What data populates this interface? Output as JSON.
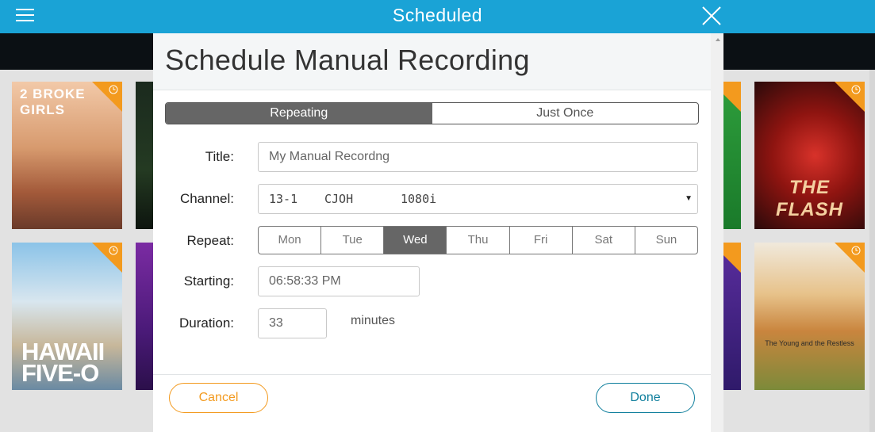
{
  "topbar": {
    "title": "Scheduled",
    "menu_icon": "hamburger-menu-icon",
    "close_icon": "close-icon",
    "color": "#1aa3d6"
  },
  "posters": {
    "broke_girls": {
      "caption": "2 BROKE GIRLS"
    },
    "hawaii_five_o": {
      "caption": "HAWAII FIVE-O"
    },
    "the_flash": {
      "caption": "THE FLASH"
    },
    "young_restless": {
      "caption": "The Young and the Restless"
    },
    "badge_icon": "clock-icon",
    "badge_color": "#f39a1e"
  },
  "modal": {
    "title": "Schedule Manual Recording",
    "mode": {
      "options": [
        "Repeating",
        "Just Once"
      ],
      "selected": "Repeating"
    },
    "title_label": "Title:",
    "title_value": "My Manual Recordng",
    "channel_label": "Channel:",
    "channel": {
      "number": "13-1",
      "name": "CJOH",
      "resolution": "1080i"
    },
    "repeat_label": "Repeat:",
    "days": [
      "Mon",
      "Tue",
      "Wed",
      "Thu",
      "Fri",
      "Sat",
      "Sun"
    ],
    "selected_day": "Wed",
    "starting_label": "Starting:",
    "starting_value": "06:58:33 PM",
    "duration_label": "Duration:",
    "duration_value": "33",
    "duration_unit": "minutes",
    "cancel_label": "Cancel",
    "done_label": "Done"
  },
  "colors": {
    "accent_orange": "#f39a1e",
    "accent_teal": "#0e7e9c",
    "segment_active": "#666666"
  }
}
